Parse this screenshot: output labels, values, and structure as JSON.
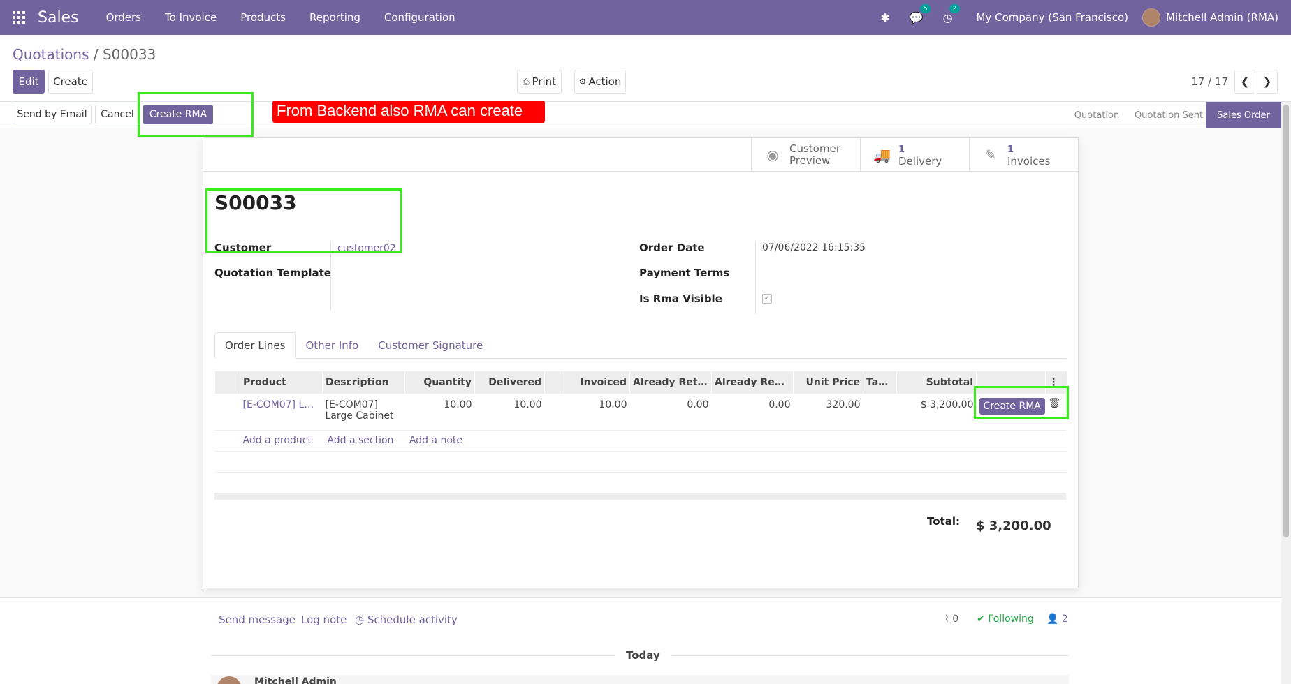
{
  "navbar": {
    "brand": "Sales",
    "items": [
      "Orders",
      "To Invoice",
      "Products",
      "Reporting",
      "Configuration"
    ],
    "chat_badge": "5",
    "activity_badge": "2",
    "company": "My Company (San Francisco)",
    "user": "Mitchell Admin (RMA)"
  },
  "breadcrumb": {
    "parent": "Quotations",
    "sep": "/",
    "current": "S00033"
  },
  "toolbar": {
    "edit": "Edit",
    "create": "Create",
    "print": "Print",
    "action": "Action",
    "pager": "17 / 17"
  },
  "statusbar": {
    "send_email": "Send by Email",
    "cancel": "Cancel",
    "create_rma": "Create RMA",
    "stages": [
      "Quotation",
      "Quotation Sent",
      "Sales Order"
    ],
    "active_stage": "Sales Order"
  },
  "annotation": {
    "note": "From Backend also RMA can create"
  },
  "stat_buttons": {
    "preview_l1": "Customer",
    "preview_l2": "Preview",
    "delivery_count": "1",
    "delivery_label": "Delivery",
    "invoice_count": "1",
    "invoice_label": "Invoices"
  },
  "form": {
    "name": "S00033",
    "customer_label": "Customer",
    "customer": "customer02",
    "template_label": "Quotation Template",
    "order_date_label": "Order Date",
    "order_date": "07/06/2022 16:15:35",
    "payment_terms_label": "Payment Terms",
    "rma_visible_label": "Is Rma Visible",
    "rma_visible": true
  },
  "tabs": [
    "Order Lines",
    "Other Info",
    "Customer Signature"
  ],
  "order_lines": {
    "headers": [
      "Product",
      "Description",
      "Quantity",
      "Delivered",
      "Invoiced",
      "Already Retu…",
      "Already Repl…",
      "Unit Price",
      "Tax…",
      "Subtotal"
    ],
    "rows": [
      {
        "product": "[E-COM07] La…",
        "description_l1": "[E-COM07]",
        "description_l2": "Large Cabinet",
        "quantity": "10.00",
        "delivered": "10.00",
        "invoiced": "10.00",
        "returned": "0.00",
        "replaced": "0.00",
        "unit_price": "320.00",
        "taxes": "",
        "subtotal": "$ 3,200.00",
        "rma_button": "Create RMA"
      }
    ],
    "add_product": "Add a product",
    "add_section": "Add a section",
    "add_note": "Add a note"
  },
  "totals": {
    "label": "Total:",
    "value": "$ 3,200.00"
  },
  "chatter": {
    "send_message": "Send message",
    "log_note": "Log note",
    "schedule": "Schedule activity",
    "attachments": "0",
    "following": "Following",
    "followers": "2",
    "today": "Today",
    "author": "Mitchell Admin"
  },
  "colors": {
    "brand": "#71639e",
    "highlight": "#3ceb1e",
    "note_bg": "#ff0000"
  }
}
